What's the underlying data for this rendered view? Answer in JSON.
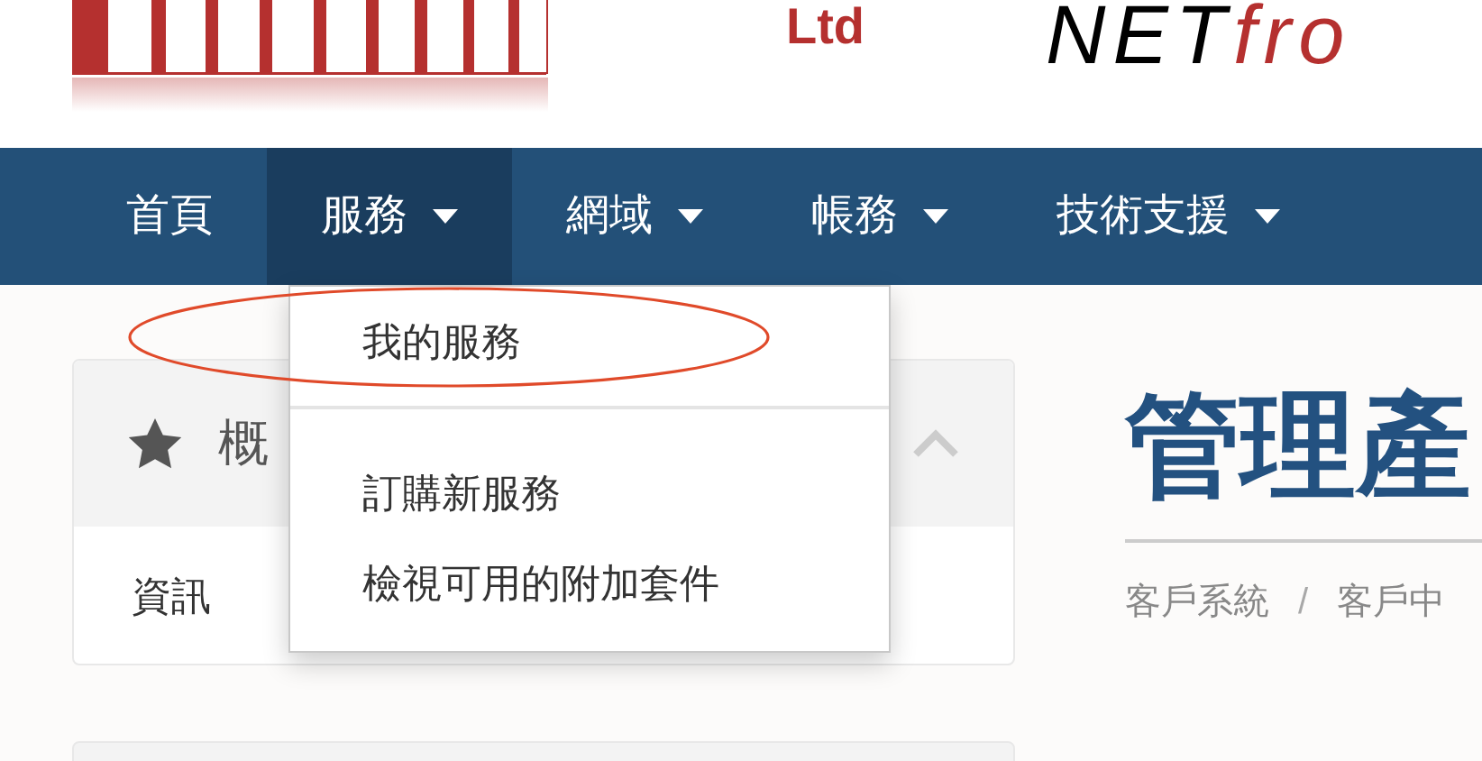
{
  "logo": {
    "suffix": "Ltd",
    "wordmark": "NET",
    "wordmark_accent": "fro"
  },
  "nav": [
    {
      "label": "首頁",
      "dropdown": false,
      "selected": false
    },
    {
      "label": "服務",
      "dropdown": true,
      "selected": true
    },
    {
      "label": "網域",
      "dropdown": true,
      "selected": false
    },
    {
      "label": "帳務",
      "dropdown": true,
      "selected": false
    },
    {
      "label": "技術支援",
      "dropdown": true,
      "selected": false
    }
  ],
  "dropdown_menu": {
    "groups": [
      [
        "我的服務"
      ],
      [
        "訂購新服務",
        "檢視可用的附加套件"
      ]
    ]
  },
  "panel": {
    "title": "概",
    "expanded": true,
    "items": [
      "資訊"
    ]
  },
  "page_header": {
    "title": "管理產",
    "breadcrumb": [
      "客戶系統",
      "客戶中"
    ],
    "separator": "/"
  }
}
